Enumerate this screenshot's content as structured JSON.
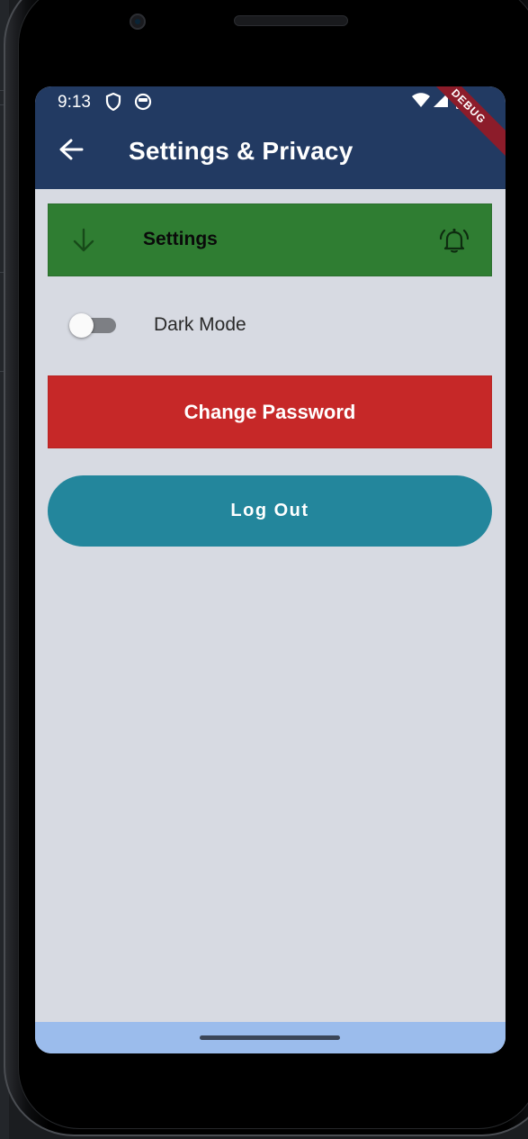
{
  "statusbar": {
    "time": "9:13",
    "icons": [
      "shield-icon",
      "face-icon",
      "wifi-icon",
      "signal-icon",
      "battery-icon"
    ]
  },
  "appbar": {
    "back_icon": "arrow-back-icon",
    "title": "Settings & Privacy",
    "color": "#223a62"
  },
  "debug_banner": "DEBUG",
  "settings_tile": {
    "leading_icon": "arrow-down-icon",
    "label": "Settings",
    "trailing_icon": "alarm-bell-icon",
    "color": "#2f7d32"
  },
  "dark_mode": {
    "label": "Dark Mode",
    "enabled": false
  },
  "change_password": {
    "label": "Change Password",
    "color": "#c62828"
  },
  "logout": {
    "label": "Log Out",
    "color": "#23869c"
  },
  "background_color": "#d7dae2",
  "navbar_color": "#9bbcec"
}
